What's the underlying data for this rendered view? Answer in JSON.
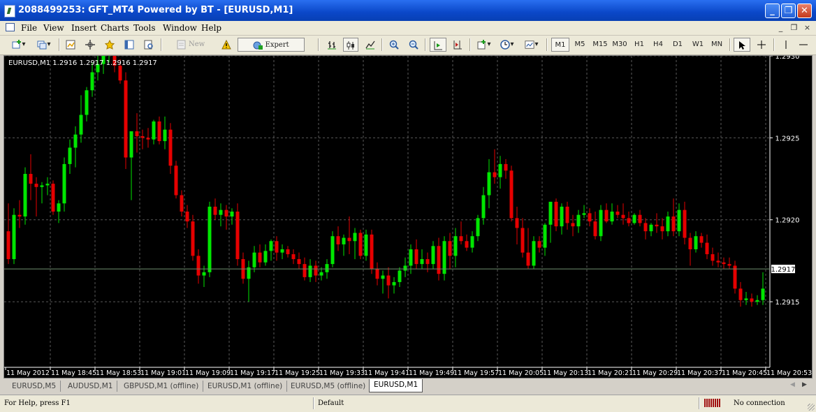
{
  "window": {
    "title": "2088499253: GFT_MT4 Powered by BT - [EURUSD,M1]"
  },
  "menu": [
    "File",
    "View",
    "Insert",
    "Charts",
    "Tools",
    "Window",
    "Help"
  ],
  "toolbar": {
    "new_order": "New Order",
    "expert_advisors": "Expert Advisors",
    "periods": [
      "M1",
      "M5",
      "M15",
      "M30",
      "H1",
      "H4",
      "D1",
      "W1",
      "MN"
    ],
    "active_period": "M1"
  },
  "chart": {
    "info": "EURUSD,M1  1.2916 1.2917 1.2916 1.2917",
    "price_labels": [
      "1.2930",
      "1.2925",
      "1.2920",
      "1.2915"
    ],
    "current_price": "1.2917",
    "time_labels": [
      "11 May 2012",
      "11 May 18:45",
      "11 May 18:53",
      "11 May 19:01",
      "11 May 19:09",
      "11 May 19:17",
      "11 May 19:25",
      "11 May 19:33",
      "11 May 19:41",
      "11 May 19:49",
      "11 May 19:57",
      "11 May 20:05",
      "11 May 20:13",
      "11 May 20:21",
      "11 May 20:29",
      "11 May 20:37",
      "11 May 20:45",
      "11 May 20:53"
    ],
    "colors": {
      "background": "#000000",
      "bull": "#00e600",
      "bear": "#e60000",
      "grid": "#5a5a5a",
      "axis_text": "#ffffff",
      "price_line": "#6f8f6f"
    }
  },
  "chart_data": {
    "type": "candlestick",
    "title": "EURUSD,M1",
    "ylim": [
      1.2911,
      1.293
    ],
    "ohlc": [
      [
        1.29193,
        1.2921,
        1.29173,
        1.29176
      ],
      [
        1.29176,
        1.29207,
        1.29173,
        1.29203
      ],
      [
        1.29203,
        1.29212,
        1.29195,
        1.29202
      ],
      [
        1.29202,
        1.29232,
        1.29197,
        1.29228
      ],
      [
        1.29228,
        1.2924,
        1.29212,
        1.29222
      ],
      [
        1.29222,
        1.29226,
        1.29202,
        1.2922
      ],
      [
        1.2922,
        1.29223,
        1.2921,
        1.29221
      ],
      [
        1.29221,
        1.29226,
        1.29215,
        1.29222
      ],
      [
        1.29222,
        1.29224,
        1.29203,
        1.29205
      ],
      [
        1.29205,
        1.29212,
        1.29198,
        1.2921
      ],
      [
        1.2921,
        1.29238,
        1.29205,
        1.29234
      ],
      [
        1.29234,
        1.29249,
        1.29228,
        1.29244
      ],
      [
        1.29244,
        1.29257,
        1.29232,
        1.29252
      ],
      [
        1.29252,
        1.29276,
        1.29247,
        1.29264
      ],
      [
        1.29264,
        1.29281,
        1.2926,
        1.29279
      ],
      [
        1.29279,
        1.29296,
        1.29275,
        1.2929
      ],
      [
        1.2929,
        1.29305,
        1.29285,
        1.29295
      ],
      [
        1.29295,
        1.29308,
        1.29289,
        1.293
      ],
      [
        1.293,
        1.29306,
        1.29296,
        1.29301
      ],
      [
        1.29301,
        1.29305,
        1.2929,
        1.29294
      ],
      [
        1.29294,
        1.29298,
        1.29283,
        1.29285
      ],
      [
        1.29285,
        1.2929,
        1.29231,
        1.29238
      ],
      [
        1.29238,
        1.29245,
        1.29212,
        1.29254
      ],
      [
        1.29254,
        1.29265,
        1.29241,
        1.29251
      ],
      [
        1.29251,
        1.29255,
        1.29243,
        1.2925
      ],
      [
        1.2925,
        1.29256,
        1.29244,
        1.29249
      ],
      [
        1.29249,
        1.29261,
        1.29246,
        1.2926
      ],
      [
        1.2926,
        1.29263,
        1.29246,
        1.29248
      ],
      [
        1.29248,
        1.29263,
        1.29243,
        1.29255
      ],
      [
        1.29255,
        1.29259,
        1.29228,
        1.29233
      ],
      [
        1.29233,
        1.29236,
        1.29213,
        1.29215
      ],
      [
        1.29215,
        1.29218,
        1.29202,
        1.29205
      ],
      [
        1.29205,
        1.29209,
        1.29195,
        1.29199
      ],
      [
        1.29199,
        1.29203,
        1.29175,
        1.29178
      ],
      [
        1.29178,
        1.29182,
        1.29161,
        1.29166
      ],
      [
        1.29166,
        1.29172,
        1.29159,
        1.29168
      ],
      [
        1.29168,
        1.29211,
        1.29165,
        1.29208
      ],
      [
        1.29208,
        1.29213,
        1.292,
        1.29203
      ],
      [
        1.29203,
        1.2921,
        1.29196,
        1.29206
      ],
      [
        1.29206,
        1.29209,
        1.29194,
        1.29202
      ],
      [
        1.29202,
        1.29207,
        1.29197,
        1.29205
      ],
      [
        1.29205,
        1.2921,
        1.29172,
        1.29176
      ],
      [
        1.29176,
        1.2918,
        1.29161,
        1.29164
      ],
      [
        1.29164,
        1.29175,
        1.2915,
        1.29171
      ],
      [
        1.29171,
        1.29184,
        1.29168,
        1.2918
      ],
      [
        1.2918,
        1.29185,
        1.29171,
        1.29174
      ],
      [
        1.29174,
        1.29185,
        1.29172,
        1.29181
      ],
      [
        1.29181,
        1.29188,
        1.29175,
        1.29187
      ],
      [
        1.29187,
        1.2919,
        1.29175,
        1.2918
      ],
      [
        1.2918,
        1.29185,
        1.29176,
        1.29182
      ],
      [
        1.29182,
        1.29184,
        1.29177,
        1.29179
      ],
      [
        1.29179,
        1.29182,
        1.29173,
        1.29176
      ],
      [
        1.29176,
        1.2918,
        1.2917,
        1.29173
      ],
      [
        1.29173,
        1.29177,
        1.29163,
        1.29165
      ],
      [
        1.29165,
        1.29176,
        1.29162,
        1.29172
      ],
      [
        1.29172,
        1.29175,
        1.29162,
        1.29166
      ],
      [
        1.29166,
        1.29171,
        1.29163,
        1.29168
      ],
      [
        1.29168,
        1.29176,
        1.29164,
        1.29173
      ],
      [
        1.29173,
        1.29193,
        1.29171,
        1.2919
      ],
      [
        1.2919,
        1.29196,
        1.29181,
        1.29185
      ],
      [
        1.29185,
        1.29191,
        1.29178,
        1.29189
      ],
      [
        1.29189,
        1.29202,
        1.29179,
        1.29187
      ],
      [
        1.29187,
        1.29195,
        1.29176,
        1.29192
      ],
      [
        1.29192,
        1.29194,
        1.29176,
        1.29178
      ],
      [
        1.29178,
        1.29194,
        1.29175,
        1.29191
      ],
      [
        1.29191,
        1.29194,
        1.29167,
        1.2917
      ],
      [
        1.2917,
        1.29174,
        1.2916,
        1.29164
      ],
      [
        1.29164,
        1.29169,
        1.29155,
        1.29166
      ],
      [
        1.29166,
        1.29171,
        1.29152,
        1.2916
      ],
      [
        1.2916,
        1.29165,
        1.29155,
        1.29162
      ],
      [
        1.29162,
        1.29171,
        1.29159,
        1.29169
      ],
      [
        1.29169,
        1.29177,
        1.29165,
        1.29172
      ],
      [
        1.29172,
        1.29185,
        1.29167,
        1.29182
      ],
      [
        1.29182,
        1.29188,
        1.2917,
        1.29173
      ],
      [
        1.29173,
        1.29182,
        1.2917,
        1.29176
      ],
      [
        1.29176,
        1.2918,
        1.29168,
        1.29173
      ],
      [
        1.29173,
        1.29187,
        1.2917,
        1.29184
      ],
      [
        1.29184,
        1.29189,
        1.29163,
        1.29167
      ],
      [
        1.29167,
        1.2919,
        1.29163,
        1.29187
      ],
      [
        1.29187,
        1.29192,
        1.2917,
        1.29178
      ],
      [
        1.29178,
        1.29195,
        1.29171,
        1.2919
      ],
      [
        1.2919,
        1.29199,
        1.29185,
        1.29187
      ],
      [
        1.29187,
        1.29191,
        1.29181,
        1.29183
      ],
      [
        1.29183,
        1.29193,
        1.2918,
        1.2919
      ],
      [
        1.2919,
        1.29203,
        1.29187,
        1.29201
      ],
      [
        1.29201,
        1.2922,
        1.29197,
        1.29215
      ],
      [
        1.29215,
        1.29237,
        1.29207,
        1.29229
      ],
      [
        1.29229,
        1.29243,
        1.29222,
        1.29226
      ],
      [
        1.29226,
        1.29239,
        1.29219,
        1.29234
      ],
      [
        1.29234,
        1.29237,
        1.29225,
        1.2923
      ],
      [
        1.2923,
        1.29233,
        1.29199,
        1.29201
      ],
      [
        1.29201,
        1.29208,
        1.29185,
        1.29195
      ],
      [
        1.29195,
        1.29201,
        1.29177,
        1.2918
      ],
      [
        1.2918,
        1.29195,
        1.2917,
        1.29172
      ],
      [
        1.29172,
        1.2919,
        1.2917,
        1.29187
      ],
      [
        1.29187,
        1.2919,
        1.2918,
        1.29183
      ],
      [
        1.29183,
        1.29198,
        1.29178,
        1.29197
      ],
      [
        1.29197,
        1.29209,
        1.29186,
        1.29211
      ],
      [
        1.29211,
        1.29213,
        1.29193,
        1.29196
      ],
      [
        1.29196,
        1.2921,
        1.29191,
        1.29208
      ],
      [
        1.29208,
        1.29211,
        1.29194,
        1.29198
      ],
      [
        1.29198,
        1.29203,
        1.2919,
        1.29196
      ],
      [
        1.29196,
        1.29206,
        1.29192,
        1.29203
      ],
      [
        1.29203,
        1.29209,
        1.29201,
        1.29204
      ],
      [
        1.29204,
        1.29207,
        1.29196,
        1.29199
      ],
      [
        1.29199,
        1.29205,
        1.29188,
        1.2919
      ],
      [
        1.2919,
        1.29209,
        1.29187,
        1.29206
      ],
      [
        1.29206,
        1.2921,
        1.29198,
        1.29199
      ],
      [
        1.29199,
        1.2921,
        1.29197,
        1.29205
      ],
      [
        1.29205,
        1.29209,
        1.29201,
        1.29203
      ],
      [
        1.29203,
        1.2921,
        1.29197,
        1.29201
      ],
      [
        1.29201,
        1.29205,
        1.29196,
        1.29198
      ],
      [
        1.29198,
        1.29204,
        1.29197,
        1.29203
      ],
      [
        1.29203,
        1.29206,
        1.29196,
        1.29198
      ],
      [
        1.29198,
        1.29201,
        1.29188,
        1.29193
      ],
      [
        1.29193,
        1.29198,
        1.2919,
        1.29197
      ],
      [
        1.29197,
        1.29204,
        1.29192,
        1.29196
      ],
      [
        1.29196,
        1.29201,
        1.29188,
        1.29193
      ],
      [
        1.29193,
        1.29205,
        1.2919,
        1.29202
      ],
      [
        1.29202,
        1.29213,
        1.2919,
        1.29193
      ],
      [
        1.29193,
        1.2921,
        1.2919,
        1.29206
      ],
      [
        1.29206,
        1.29211,
        1.29185,
        1.29189
      ],
      [
        1.29189,
        1.29192,
        1.29172,
        1.29182
      ],
      [
        1.29182,
        1.29193,
        1.2918,
        1.2919
      ],
      [
        1.2919,
        1.29192,
        1.29183,
        1.29186
      ],
      [
        1.29186,
        1.29191,
        1.29176,
        1.29179
      ],
      [
        1.29179,
        1.29183,
        1.29172,
        1.29175
      ],
      [
        1.29175,
        1.2918,
        1.29171,
        1.29174
      ],
      [
        1.29174,
        1.29177,
        1.2917,
        1.29173
      ],
      [
        1.29173,
        1.29177,
        1.2917,
        1.29172
      ],
      [
        1.29172,
        1.29175,
        1.29155,
        1.29158
      ],
      [
        1.29158,
        1.29162,
        1.29147,
        1.29151
      ],
      [
        1.29151,
        1.29156,
        1.29148,
        1.29152
      ],
      [
        1.29152,
        1.29155,
        1.29147,
        1.2915
      ],
      [
        1.2915,
        1.29154,
        1.29148,
        1.29151
      ],
      [
        1.29151,
        1.29168,
        1.29148,
        1.29158
      ],
      [
        1.29158,
        1.29163,
        1.29146,
        1.29151
      ],
      [
        1.29151,
        1.29163,
        1.29148,
        1.29162
      ],
      [
        1.29162,
        1.29165,
        1.29145,
        1.29148
      ],
      [
        1.29148,
        1.29154,
        1.29144,
        1.29149
      ],
      [
        1.29149,
        1.29152,
        1.29145,
        1.29147
      ],
      [
        1.29147,
        1.29153,
        1.29145,
        1.29149
      ],
      [
        1.29149,
        1.29152,
        1.29143,
        1.29145
      ],
      [
        1.29145,
        1.29151,
        1.29144,
        1.29148
      ],
      [
        1.29148,
        1.29157,
        1.29145,
        1.29156
      ],
      [
        1.29156,
        1.29164,
        1.29152,
        1.2916
      ],
      [
        1.2916,
        1.2917,
        1.29155,
        1.2917
      ]
    ]
  },
  "tabs": [
    {
      "label": "EURUSD,M5",
      "active": false
    },
    {
      "label": "AUDUSD,M1",
      "active": false
    },
    {
      "label": "GBPUSD,M1 (offline)",
      "active": false
    },
    {
      "label": "EURUSD,M1 (offline)",
      "active": false
    },
    {
      "label": "EURUSD,M5 (offline)",
      "active": false
    },
    {
      "label": "EURUSD,M1",
      "active": true
    }
  ],
  "status": {
    "help": "For Help, press F1",
    "profile": "Default",
    "connection": "No connection"
  }
}
